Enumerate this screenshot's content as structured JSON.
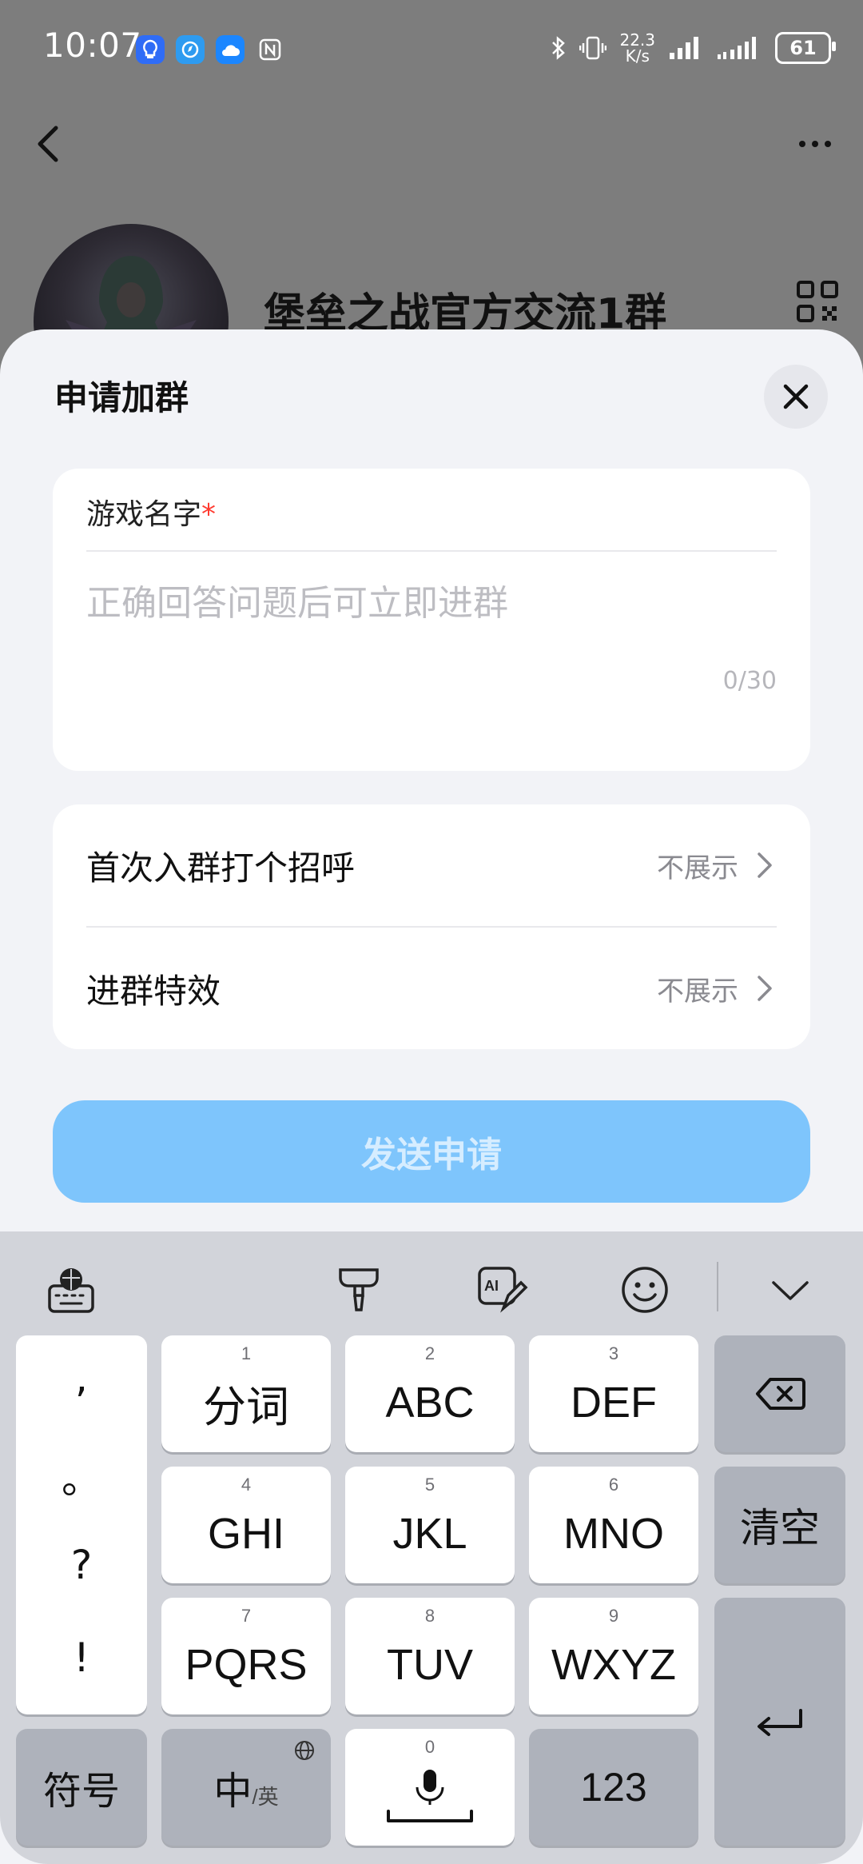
{
  "status_bar": {
    "time": "10:07",
    "net_speed_value": "22.3",
    "net_speed_unit": "K/s",
    "battery": "61"
  },
  "group": {
    "title": "堡垒之战官方交流1群"
  },
  "sheet": {
    "title": "申请加群",
    "question": {
      "label": "游戏名字",
      "required_mark": "*",
      "placeholder": "正确回答问题后可立即进群",
      "value": "",
      "char_count": "0/30"
    },
    "options": [
      {
        "label": "首次入群打个招呼",
        "value": "不展示"
      },
      {
        "label": "进群特效",
        "value": "不展示"
      }
    ],
    "send_button": "发送申请"
  },
  "keyboard": {
    "punctuation": [
      ",",
      "。",
      "?",
      "!"
    ],
    "keys": {
      "k1": {
        "num": "1",
        "label": "分词"
      },
      "k2": {
        "num": "2",
        "label": "ABC"
      },
      "k3": {
        "num": "3",
        "label": "DEF"
      },
      "k4": {
        "num": "4",
        "label": "GHI"
      },
      "k5": {
        "num": "5",
        "label": "JKL"
      },
      "k6": {
        "num": "6",
        "label": "MNO"
      },
      "k7": {
        "num": "7",
        "label": "PQRS"
      },
      "k8": {
        "num": "8",
        "label": "TUV"
      },
      "k9": {
        "num": "9",
        "label": "WXYZ"
      },
      "k0": {
        "num": "0"
      }
    },
    "clear": "清空",
    "symbols": "符号",
    "lang_main": "中",
    "lang_sub": "/英",
    "numbers": "123"
  },
  "colors": {
    "accent_disabled": "#7ec5fc",
    "required": "#ff3b30"
  }
}
